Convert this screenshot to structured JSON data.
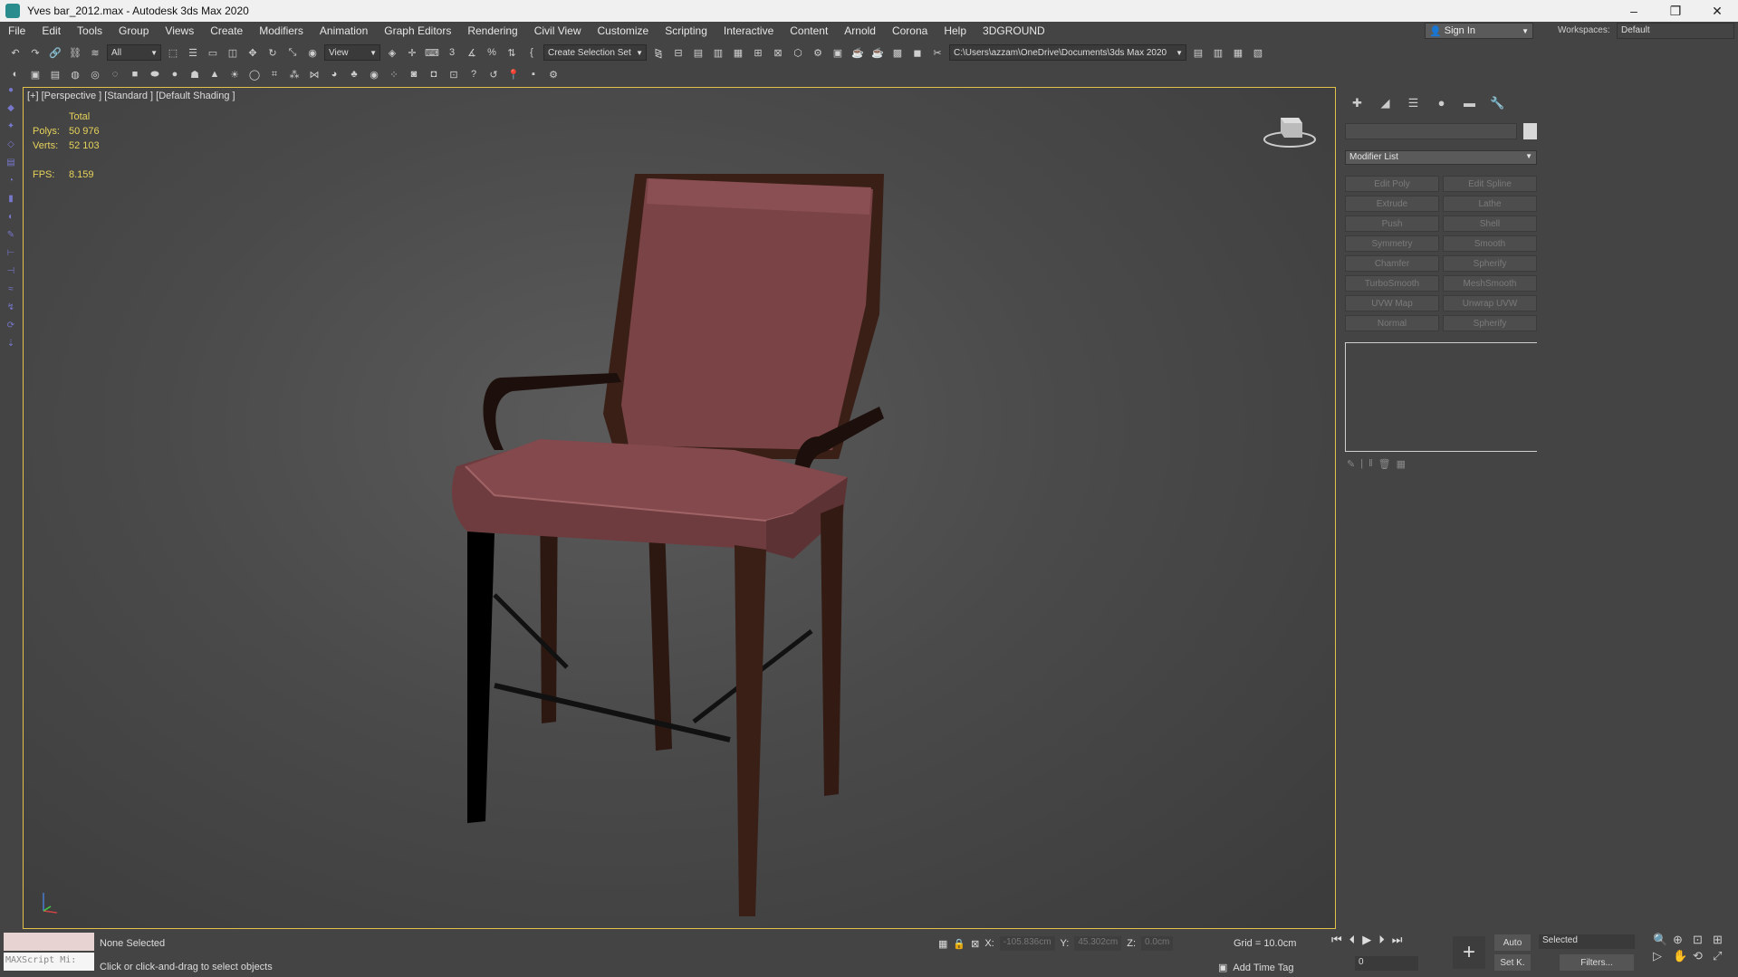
{
  "window": {
    "title": "Yves bar_2012.max - Autodesk 3ds Max 2020",
    "minimize": "–",
    "maximize": "❐",
    "close": "✕"
  },
  "menu": {
    "items": [
      "File",
      "Edit",
      "Tools",
      "Group",
      "Views",
      "Create",
      "Modifiers",
      "Animation",
      "Graph Editors",
      "Rendering",
      "Civil View",
      "Customize",
      "Scripting",
      "Interactive",
      "Content",
      "Arnold",
      "Corona",
      "Help",
      "3DGROUND"
    ],
    "sign_in": "Sign In",
    "workspaces_label": "Workspaces:",
    "workspace_value": "Default"
  },
  "toolbar": {
    "filter_value": "All",
    "ref_coord_value": "View",
    "selection_set": "Create Selection Set",
    "project_path": "C:\\Users\\azzam\\OneDrive\\Documents\\3ds Max 2020"
  },
  "viewport": {
    "label": "[+] [Perspective ] [Standard ] [Default Shading ]",
    "stats_total": "Total",
    "polys_label": "Polys:",
    "polys_value": "50 976",
    "verts_label": "Verts:",
    "verts_value": "52 103",
    "fps_label": "FPS:",
    "fps_value": "8.159"
  },
  "command_panel": {
    "modifier_list": "Modifier List",
    "modifiers": [
      "Edit Poly",
      "Edit Spline",
      "Extrude",
      "Lathe",
      "Push",
      "Shell",
      "Symmetry",
      "Smooth",
      "Chamfer",
      "Spherify",
      "TurboSmooth",
      "MeshSmooth",
      "UVW Map",
      "Unwrap UVW",
      "Normal",
      "Spherify"
    ]
  },
  "status": {
    "selection": "None Selected",
    "hint": "Click or click-and-drag to select objects",
    "maxscript": "MAXScript Mi:",
    "x_label": "X:",
    "x_value": "-105.836cm",
    "y_label": "Y:",
    "y_value": "45.302cm",
    "z_label": "Z:",
    "z_value": "0.0cm",
    "grid": "Grid = 10.0cm",
    "add_time_tag": "Add Time Tag",
    "frame": "0",
    "auto": "Auto",
    "set_key": "Set K.",
    "selected": "Selected",
    "filters": "Filters..."
  },
  "colors": {
    "viewport_border": "#e3c14a",
    "stats_text": "#e6d25a",
    "chair_fabric": "#7a4346",
    "chair_wood": "#3a1f17"
  }
}
